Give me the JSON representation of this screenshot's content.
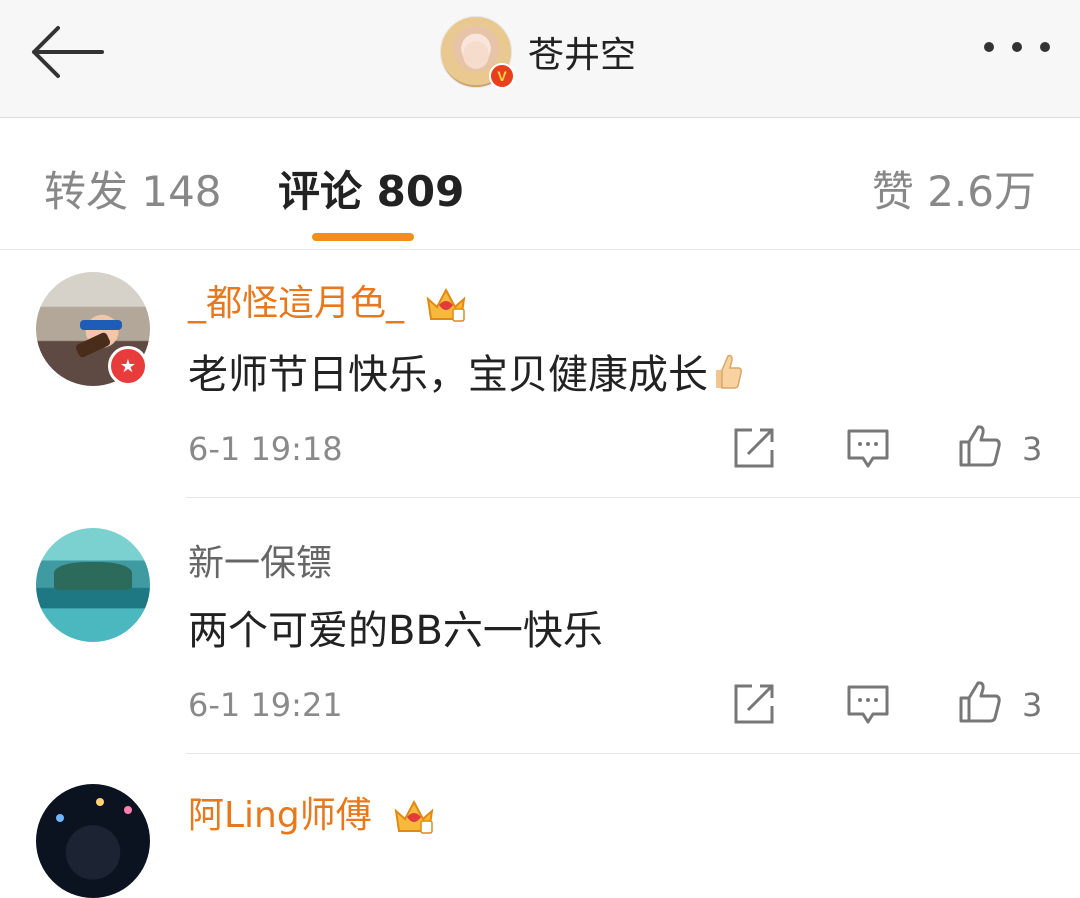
{
  "header": {
    "title": "苍井空",
    "verified_badge": "V",
    "back_icon": "back-arrow-icon",
    "more_icon": "more-dots-icon"
  },
  "tabs": {
    "repost": "转发 148",
    "comments": "评论 809",
    "likes": "赞 2.6万",
    "active": "comments"
  },
  "comments": [
    {
      "user": "_都怪這月色_",
      "vip_badge": true,
      "text": "老师节日快乐，宝贝健康成长",
      "emoji": "thumbs-up",
      "time": "6-1 19:18",
      "likes": "3"
    },
    {
      "user": "新一保镖",
      "vip_badge": false,
      "text": "两个可爱的BB六一快乐",
      "time": "6-1 19:21",
      "likes": "3"
    },
    {
      "user": "阿Ling师傅",
      "vip_badge": true
    }
  ],
  "colors": {
    "accent": "#f08f1b",
    "vip_name": "#e8781c",
    "text": "#222222",
    "muted": "#8a8a8a"
  }
}
